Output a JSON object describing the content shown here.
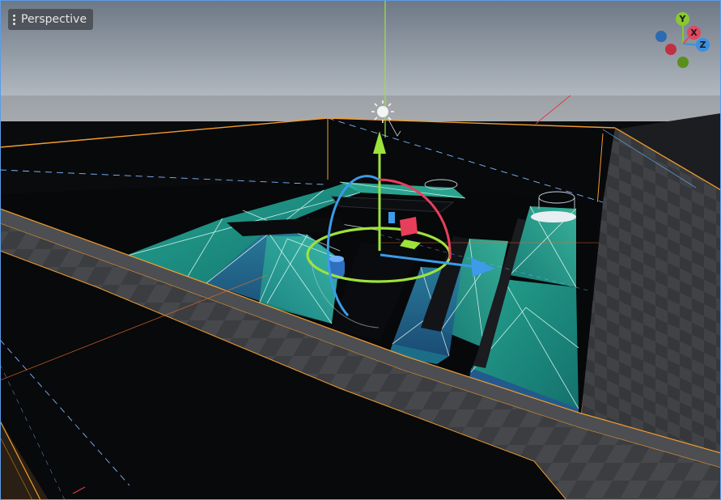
{
  "viewport": {
    "view_menu_label": "Perspective",
    "view_menu_icon": "kebab-menu-icon"
  },
  "axis_gizmo": {
    "y_label": "Y",
    "x_label": "X",
    "z_label": "Z",
    "colors": {
      "x": "#e0485e",
      "y": "#8ac733",
      "z": "#3b8fe0",
      "neg_x": "#c03042",
      "neg_y": "#5a8f1c",
      "neg_z": "#2d6ab0"
    }
  },
  "scene": {
    "sky_top": "#6f7a88",
    "sky_horizon": "#b8bec6",
    "ground": "#0b0c0e",
    "wall_color": "#3c3e42",
    "selection_outline": "#f39c2c",
    "area_fill": "#1ea392",
    "light_icon": "light-bulb-icon",
    "gizmo_colors": {
      "x": "#e83e5c",
      "y": "#9ee23c",
      "z": "#3d9be9"
    }
  }
}
